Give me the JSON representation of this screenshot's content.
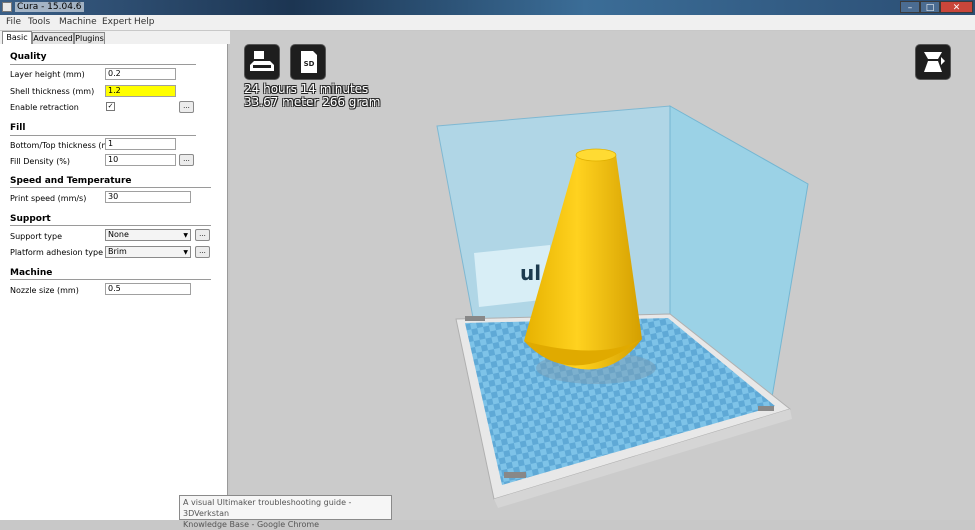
{
  "window": {
    "title": "Cura - 15.04.6",
    "min": "–",
    "max": "□",
    "close": "✕"
  },
  "menu": [
    "File",
    "Tools",
    "Machine",
    "Expert",
    "Help"
  ],
  "tabs": [
    "Basic",
    "Advanced",
    "Plugins"
  ],
  "quality": {
    "title": "Quality",
    "layer_height_label": "Layer height (mm)",
    "layer_height": "0.2",
    "shell_thickness_label": "Shell thickness (mm)",
    "shell_thickness": "1.2",
    "retraction_label": "Enable retraction",
    "retraction_check": "✓"
  },
  "fill": {
    "title": "Fill",
    "bottom_top_label": "Bottom/Top thickness (mm)",
    "bottom_top": "1",
    "density_label": "Fill Density (%)",
    "density": "10"
  },
  "speed": {
    "title": "Speed and Temperature",
    "print_speed_label": "Print speed (mm/s)",
    "print_speed": "30"
  },
  "support": {
    "title": "Support",
    "type_label": "Support type",
    "type": "None",
    "adhesion_label": "Platform adhesion type",
    "adhesion": "Brim"
  },
  "machine": {
    "title": "Machine",
    "nozzle_label": "Nozzle size (mm)",
    "nozzle": "0.5"
  },
  "more_label": "...",
  "dropdown_arrow": "▼",
  "viewport": {
    "sd_label": "SD",
    "print_time": "24 hours 14 minutes",
    "print_material": "33.67 meter 266 gram",
    "logo_text": "ul",
    "icons": [
      "load-icon",
      "sd-card-icon",
      "view-mode-icon"
    ]
  },
  "tooltip": {
    "line1": "A visual Ultimaker troubleshooting guide - 3DVerkstan",
    "line2": "Knowledge Base - Google Chrome"
  },
  "colors": {
    "cone": "#f5c000",
    "build_volume": "#8fd3ec",
    "platform": "#7ec3e8",
    "tooltip_bg": "#f6f6f6",
    "highlight": "#ffff00"
  }
}
